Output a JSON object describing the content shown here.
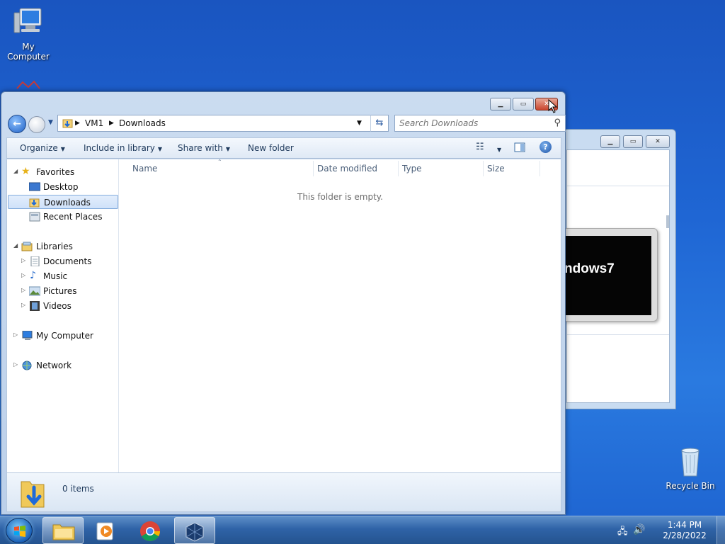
{
  "desktop": {
    "icons": [
      {
        "label": "My Computer"
      },
      {
        "label": "Recycle Bin"
      }
    ]
  },
  "background_window": {
    "brand_text": "ndows7"
  },
  "explorer": {
    "address": {
      "crumbs": [
        "VM1",
        "Downloads"
      ]
    },
    "search": {
      "placeholder": "Search Downloads"
    },
    "toolbar": {
      "organize": "Organize",
      "include_in_library": "Include in library",
      "share_with": "Share with",
      "new_folder": "New folder"
    },
    "nav": {
      "favorites": "Favorites",
      "desktop": "Desktop",
      "downloads": "Downloads",
      "recent_places": "Recent Places",
      "libraries": "Libraries",
      "documents": "Documents",
      "music": "Music",
      "pictures": "Pictures",
      "videos": "Videos",
      "my_computer": "My Computer",
      "network": "Network"
    },
    "columns": [
      "Name",
      "Date modified",
      "Type",
      "Size"
    ],
    "empty_message": "This folder is empty.",
    "status": {
      "item_count": "0 items"
    }
  },
  "taskbar": {
    "clock": {
      "time": "1:44 PM",
      "date": "2/28/2022"
    }
  },
  "colors": {
    "desktop_blue": "#1f66d4",
    "selection": "#cfe1f9",
    "close_button": "#c9452e"
  }
}
